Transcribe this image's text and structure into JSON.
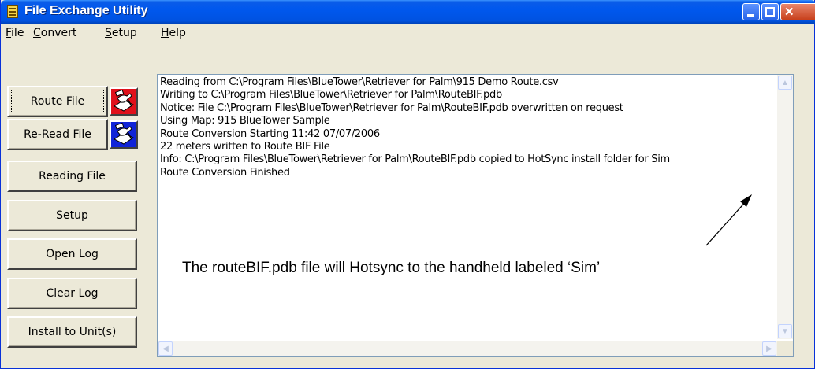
{
  "window": {
    "title": "File Exchange Utility"
  },
  "menu": [
    {
      "pre": "",
      "ul": "F",
      "post": "ile"
    },
    {
      "pre": "",
      "ul": "C",
      "post": "onvert"
    },
    {
      "pre": "",
      "ul": "S",
      "post": "etup"
    },
    {
      "pre": "",
      "ul": "H",
      "post": "elp"
    }
  ],
  "buttons": {
    "route_file": "Route File",
    "reread_file": "Re-Read File",
    "reading_file": "Reading File",
    "setup": "Setup",
    "open_log": "Open Log",
    "clear_log": "Clear Log",
    "install_units": "Install to Unit(s)"
  },
  "log": {
    "lines": [
      "Reading from C:\\Program Files\\BlueTower\\Retriever for Palm\\915 Demo Route.csv",
      "Writing to C:\\Program Files\\BlueTower\\Retriever for Palm\\RouteBIF.pdb",
      "Notice: File C:\\Program Files\\BlueTower\\Retriever for Palm\\RouteBIF.pdb overwritten on request",
      "Using Map: 915 BlueTower Sample",
      "Route Conversion Starting 11:42 07/07/2006",
      "22 meters written to Route BIF File",
      "Info: C:\\Program Files\\BlueTower\\Retriever for Palm\\RouteBIF.pdb copied to HotSync install folder for Sim",
      "Route Conversion Finished"
    ]
  },
  "annotation": {
    "text": "The routeBIF.pdb file will Hotsync to the handheld labeled ‘Sim’"
  },
  "icons": {
    "app": "notepad-icon",
    "route_pic": "hand-writing-red-icon",
    "reread_pic": "hand-writing-blue-icon"
  },
  "colors": {
    "titlebar": "#0058ee",
    "window_face": "#ece9d8",
    "route_pic_bg": "#e0101a",
    "reread_pic_bg": "#1024d8"
  }
}
